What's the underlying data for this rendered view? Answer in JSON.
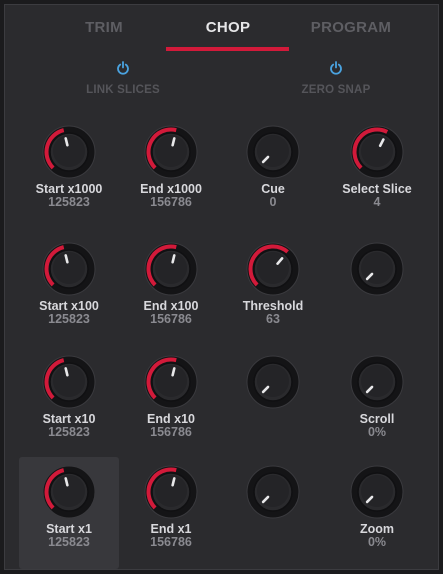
{
  "tabs": [
    {
      "label": "TRIM",
      "active": false
    },
    {
      "label": "CHOP",
      "active": true
    },
    {
      "label": "PROGRAM",
      "active": false
    }
  ],
  "toggles": [
    {
      "label": "LINK SLICES",
      "icon": "power-icon",
      "color": "#4aa3e0"
    },
    {
      "label": "ZERO SNAP",
      "icon": "power-icon",
      "color": "#4aa3e0"
    }
  ],
  "accent_color": "#d21a3a",
  "knobs": [
    {
      "label": "Start x1000",
      "value": "125823",
      "level": 0.45
    },
    {
      "label": "End x1000",
      "value": "156786",
      "level": 0.55
    },
    {
      "label": "Cue",
      "value": "0",
      "level": 0.0
    },
    {
      "label": "Select Slice",
      "value": "4",
      "level": 0.6
    },
    {
      "label": "Start x100",
      "value": "125823",
      "level": 0.45
    },
    {
      "label": "End x100",
      "value": "156786",
      "level": 0.55
    },
    {
      "label": "Threshold",
      "value": "63",
      "level": 0.65
    },
    {
      "label": "",
      "value": "",
      "level": 0.0
    },
    {
      "label": "Start x10",
      "value": "125823",
      "level": 0.45
    },
    {
      "label": "End x10",
      "value": "156786",
      "level": 0.55
    },
    {
      "label": "",
      "value": "",
      "level": 0.0
    },
    {
      "label": "Scroll",
      "value": "0%",
      "level": 0.0
    },
    {
      "label": "Start x1",
      "value": "125823",
      "level": 0.45
    },
    {
      "label": "End x1",
      "value": "156786",
      "level": 0.55
    },
    {
      "label": "",
      "value": "",
      "level": 0.0
    },
    {
      "label": "Zoom",
      "value": "0%",
      "level": 0.0
    }
  ]
}
